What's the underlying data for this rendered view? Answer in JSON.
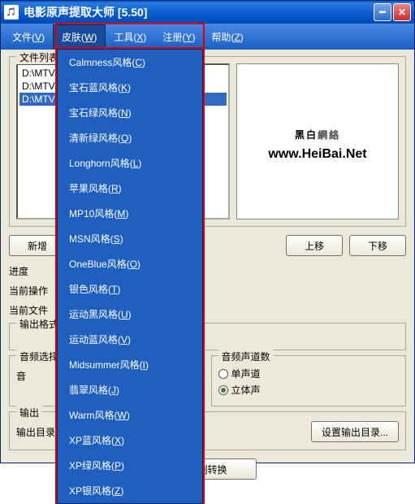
{
  "titlebar": {
    "icon": "🎵",
    "title": "电影原声提取大师  [5.50]"
  },
  "menubar": {
    "items": [
      {
        "label": "文件",
        "accel": "V"
      },
      {
        "label": "皮肤",
        "accel": "W"
      },
      {
        "label": "工具",
        "accel": "X"
      },
      {
        "label": "注册",
        "accel": "Y"
      },
      {
        "label": "帮助",
        "accel": "Z"
      }
    ]
  },
  "dropdown": {
    "items": [
      {
        "label": "Calmness风格",
        "accel": "C"
      },
      {
        "label": "宝石蓝风格",
        "accel": "K"
      },
      {
        "label": "宝石绿风格",
        "accel": "N"
      },
      {
        "label": "清新绿风格",
        "accel": "Q"
      },
      {
        "label": "Longhorn风格",
        "accel": "L"
      },
      {
        "label": "苹果风格",
        "accel": "R"
      },
      {
        "label": "MP10风格",
        "accel": "M"
      },
      {
        "label": "MSN风格",
        "accel": "S"
      },
      {
        "label": "OneBlue风格",
        "accel": "O"
      },
      {
        "label": "银色风格",
        "accel": "T"
      },
      {
        "label": "运动黑风格",
        "accel": "U"
      },
      {
        "label": "运动蓝风格",
        "accel": "V"
      },
      {
        "label": "Midsummer风格",
        "accel": "I"
      },
      {
        "label": "翡翠风格",
        "accel": "J"
      },
      {
        "label": "Warm风格",
        "accel": "W"
      },
      {
        "label": "XP蓝风格",
        "accel": "X"
      },
      {
        "label": "XP绿风格",
        "accel": "P"
      },
      {
        "label": "XP银风格",
        "accel": "Z"
      }
    ]
  },
  "filelist": {
    "label": "文件列表",
    "rows": [
      "D:\\MTV\\",
      "D:\\MTV\\",
      "D:\\MTV\\"
    ],
    "selected_index": 2
  },
  "preview": {
    "logo_black": "黑白",
    "logo_outline": "網絡",
    "url": "www.HeiBai.Net"
  },
  "buttons": {
    "add": "新增",
    "up": "上移",
    "down": "下移",
    "set_output": "设置输出目录...",
    "convert": "立刻转换"
  },
  "progress": {
    "label": "进度",
    "current_op": "当前操作",
    "current_file": "当前文件"
  },
  "output_format": {
    "label": "输出格式"
  },
  "audio_select": {
    "label": "音频选择",
    "sub": "音"
  },
  "channel": {
    "label": "音频声道数",
    "mono": "单声道",
    "stereo": "立体声",
    "selected": "stereo"
  },
  "output": {
    "label": "输出",
    "dir_label": "输出目录"
  }
}
